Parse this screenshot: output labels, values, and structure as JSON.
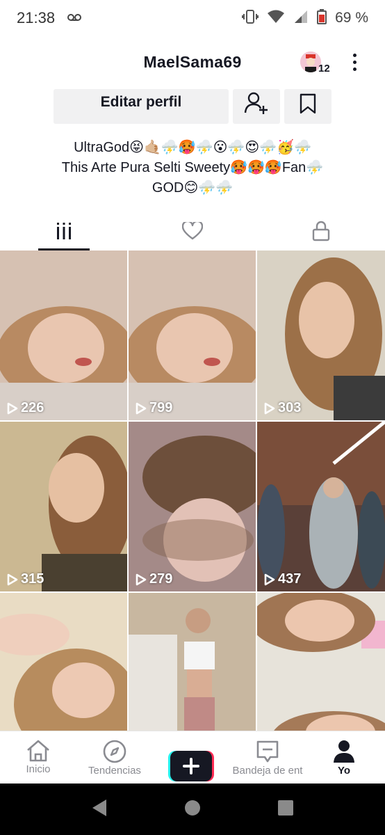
{
  "status_bar": {
    "time": "21:38",
    "voicemail_icon": "voicemail-icon",
    "battery_text": "69 %"
  },
  "header": {
    "username": "MaelSama69",
    "avatar_count": "12"
  },
  "profile": {
    "edit_label": "Editar perfil"
  },
  "bio": {
    "line1": "UltraGod😝🤙🏼⛈️🥵⛈️😮⛈️😍⛈️🥳⛈️",
    "line2": "This Arte Pura Selti Sweety🥵🥵🥵Fan⛈️",
    "line3": "GOD😊⛈️⛈️"
  },
  "tabs": [
    {
      "name": "videos",
      "icon": "grid-icon",
      "active": true
    },
    {
      "name": "liked",
      "icon": "heart-icon",
      "active": false
    },
    {
      "name": "private",
      "icon": "lock-icon",
      "active": false
    }
  ],
  "videos": [
    {
      "views": "226"
    },
    {
      "views": "799"
    },
    {
      "views": "303"
    },
    {
      "views": "315"
    },
    {
      "views": "279"
    },
    {
      "views": "437"
    },
    {
      "views": ""
    },
    {
      "views": ""
    },
    {
      "views": ""
    }
  ],
  "nav": {
    "home": "Inicio",
    "discover": "Tendencias",
    "inbox": "Bandeja de ent",
    "me": "Yo"
  },
  "colors": {
    "accent_cyan": "#25f4ee",
    "accent_pink": "#fe2c55",
    "text": "#161823"
  }
}
